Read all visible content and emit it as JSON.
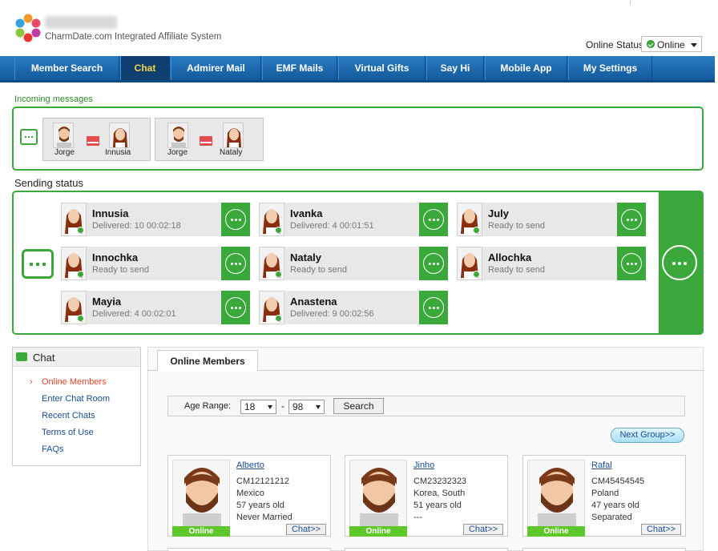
{
  "header": {
    "brand_sub": "CharmDate.com Integrated Affiliate System",
    "online_status_label": "Online Status",
    "online_status_value": "Online"
  },
  "nav": [
    {
      "label": "Member Search",
      "active": false
    },
    {
      "label": "Chat",
      "active": true
    },
    {
      "label": "Admirer Mail",
      "active": false
    },
    {
      "label": "EMF Mails",
      "active": false
    },
    {
      "label": "Virtual Gifts",
      "active": false
    },
    {
      "label": "Say Hi",
      "active": false
    },
    {
      "label": "Mobile App",
      "active": false
    },
    {
      "label": "My Settings",
      "active": false
    }
  ],
  "incoming": {
    "label": "Incoming messages",
    "pairs": [
      {
        "from": "Jorge",
        "to": "Innusia"
      },
      {
        "from": "Jorge",
        "to": "Nataly"
      }
    ]
  },
  "sending": {
    "label": "Sending status",
    "cards": [
      {
        "name": "Innusia",
        "status": "Delivered: 10  00:02:18"
      },
      {
        "name": "Ivanka",
        "status": "Delivered: 4  00:01:51"
      },
      {
        "name": "July",
        "status": "Ready to send"
      },
      {
        "name": "Innochka",
        "status": "Ready to send"
      },
      {
        "name": "Nataly",
        "status": "Ready to send"
      },
      {
        "name": "Allochka",
        "status": "Ready to send"
      },
      {
        "name": "Mayia",
        "status": "Delivered: 4  00:02:01"
      },
      {
        "name": "Anastena",
        "status": "Delivered: 9  00:02:56"
      }
    ]
  },
  "sidebar": {
    "title": "Chat",
    "links": [
      {
        "label": "Online Members",
        "selected": true
      },
      {
        "label": "Enter Chat Room",
        "selected": false
      },
      {
        "label": "Recent Chats",
        "selected": false
      },
      {
        "label": "Terms of Use",
        "selected": false
      },
      {
        "label": "FAQs",
        "selected": false
      }
    ]
  },
  "main": {
    "tab": "Online Members",
    "age_label": "Age Range:",
    "age_min": "18",
    "age_max": "98",
    "age_sep": "-",
    "search_label": "Search",
    "next_label": "Next Group>>",
    "online_badge": "Online",
    "chat_btn": "Chat>>",
    "members": [
      {
        "name": "Alberto",
        "id": "CM12121212",
        "country": "Mexico",
        "age": "57 years old",
        "status": "Never Married"
      },
      {
        "name": "Jinho",
        "id": "CM23232323",
        "country": "Korea, South",
        "age": "51 years old",
        "status": "---"
      },
      {
        "name": "Rafal",
        "id": "CM45454545",
        "country": "Poland",
        "age": "47 years old",
        "status": "Separated"
      }
    ]
  },
  "colors": {
    "accent_green": "#3aa83a",
    "nav_blue": "#1b6aae",
    "active_tab_text": "#f5d24a",
    "link_blue": "#1a4d8f",
    "selected_red": "#e0462b"
  }
}
